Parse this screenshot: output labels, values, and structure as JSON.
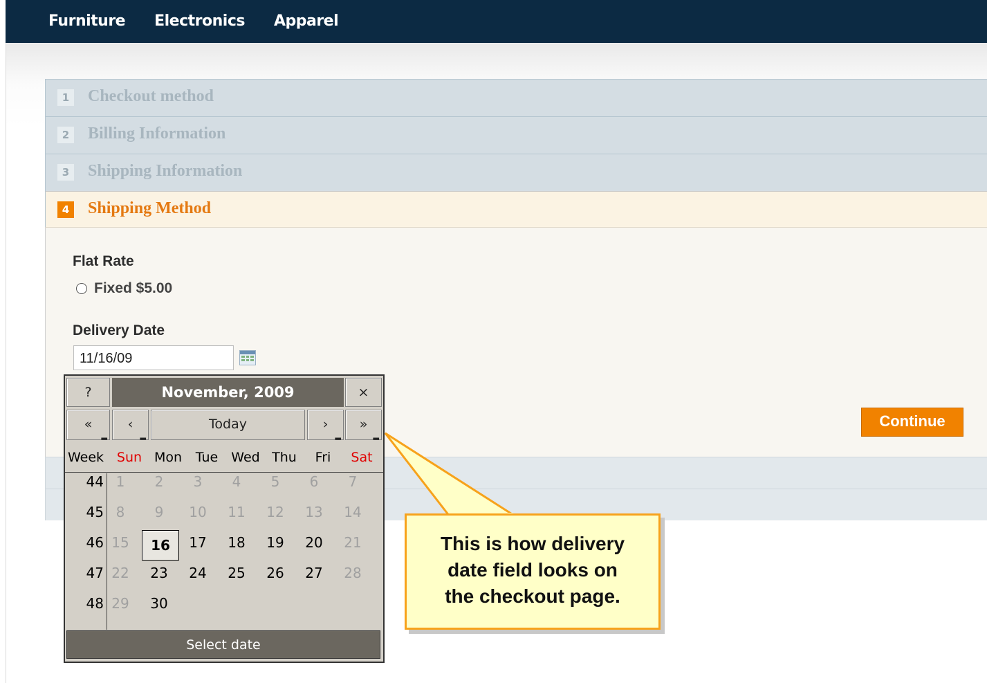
{
  "nav": [
    "Furniture",
    "Electronics",
    "Apparel"
  ],
  "checkout": {
    "steps": [
      {
        "num": "1",
        "title": "Checkout method"
      },
      {
        "num": "2",
        "title": "Billing Information"
      },
      {
        "num": "3",
        "title": "Shipping Information"
      },
      {
        "num": "4",
        "title": "Shipping Method"
      }
    ],
    "shipping": {
      "carrier": "Flat Rate",
      "option_label": "Fixed $5.00",
      "delivery_label": "Delivery Date",
      "delivery_value": "11/16/09",
      "continue_label": "Continue"
    }
  },
  "calendar": {
    "help": "?",
    "title": "November, 2009",
    "close": "×",
    "prev_year": "«",
    "prev_month": "‹",
    "today": "Today",
    "next_month": "›",
    "next_year": "»",
    "days": [
      "Week",
      "Sun",
      "Mon",
      "Tue",
      "Wed",
      "Thu",
      "Fri",
      "Sat"
    ],
    "weeks": [
      "44",
      "45",
      "46",
      "47",
      "48"
    ],
    "grid": [
      [
        "1",
        "2",
        "3",
        "4",
        "5",
        "6",
        "7"
      ],
      [
        "8",
        "9",
        "10",
        "11",
        "12",
        "13",
        "14"
      ],
      [
        "15",
        "16",
        "17",
        "18",
        "19",
        "20",
        "21"
      ],
      [
        "22",
        "23",
        "24",
        "25",
        "26",
        "27",
        "28"
      ],
      [
        "29",
        "30",
        "",
        "",
        "",
        "",
        ""
      ]
    ],
    "current_month": [
      [
        false,
        false,
        false,
        false,
        false,
        false,
        false
      ],
      [
        false,
        false,
        false,
        false,
        false,
        false,
        false
      ],
      [
        false,
        true,
        true,
        true,
        true,
        true,
        false
      ],
      [
        false,
        true,
        true,
        true,
        true,
        true,
        false
      ],
      [
        false,
        true,
        false,
        false,
        false,
        false,
        false
      ]
    ],
    "selected": "16",
    "footer": "Select date"
  },
  "callout": {
    "line1": "This is how delivery",
    "line2": "date field looks on",
    "line3": "the checkout page."
  },
  "colors": {
    "accent": "#f18200",
    "topbar": "#0c2a43",
    "callout_border": "#f7a21b",
    "weekend": "#e00000"
  }
}
